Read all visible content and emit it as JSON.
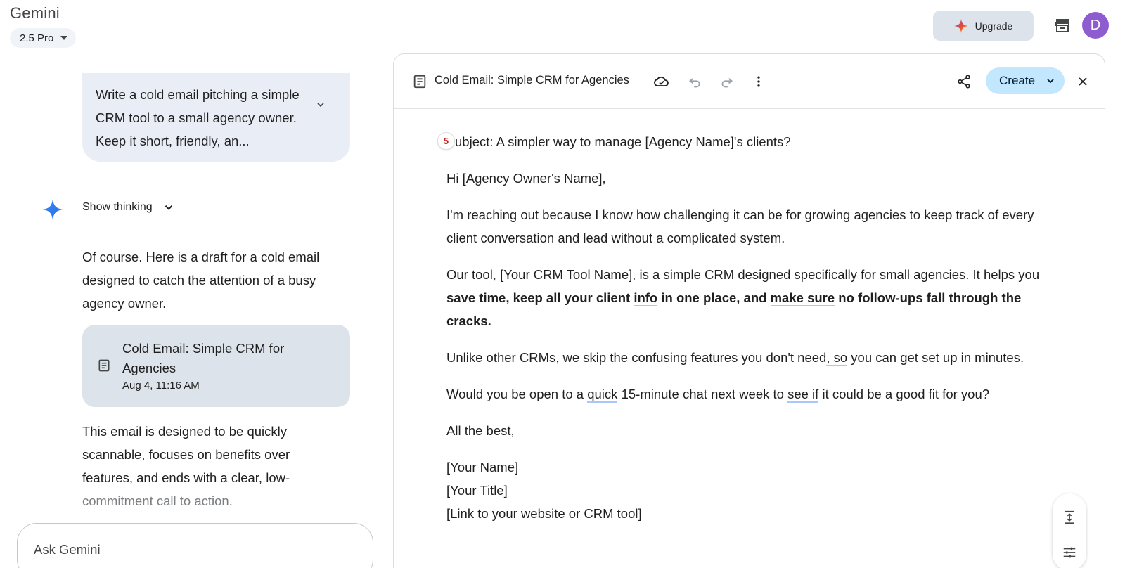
{
  "app": {
    "title": "Gemini",
    "model": "2.5 Pro"
  },
  "header": {
    "upgrade_label": "Upgrade",
    "avatar_letter": "D"
  },
  "chat": {
    "user_prompt": "Write a cold email pitching a simple CRM tool to a small agency owner. Keep it short, friendly, an...",
    "show_thinking_label": "Show thinking",
    "response_intro": "Of course. Here is a draft for a cold email designed to catch the attention of a busy agency owner.",
    "doc_card": {
      "title": "Cold Email: Simple CRM for Agencies",
      "date": "Aug 4, 11:16 AM"
    },
    "response_outro_main": "This email is designed to be quickly scannable, focuses on benefits over features, and ends with a clear, low-",
    "response_outro_faded": "commitment call to action.",
    "ask_placeholder": "Ask Gemini"
  },
  "doc_panel": {
    "title": "Cold Email: Simple CRM for Agencies",
    "create_label": "Create",
    "badge_count": "5",
    "subject": "ubject: A simpler way to manage [Agency Name]'s clients?",
    "greeting": "Hi [Agency Owner's Name],",
    "p1": "I'm reaching out because I know how challenging it can be for growing agencies to keep track of every client conversation and lead without a complicated system.",
    "p2_a": "Our tool, [Your CRM Tool Name], is a simple CRM designed specifically for small agencies. It helps you ",
    "p2_b1": "save time, keep all your client ",
    "p2_b2": "info",
    "p2_b3": " in one place, and ",
    "p2_b4": "make sure",
    "p2_b5": " no follow-ups fall through the cracks.",
    "p3_a": "Unlike other CRMs, we skip the confusing features you don't need",
    "p3_b": ", so",
    "p3_c": " you can get set up in minutes.",
    "p4_a": "Would you be open to a ",
    "p4_b": "quick",
    "p4_c": " 15-minute chat next week to ",
    "p4_d": "see if",
    "p4_e": " it could be a good fit for you?",
    "closing": "All the best,",
    "sig_name": "[Your Name]",
    "sig_title": "[Your Title]",
    "sig_link": "[Link to your website or CRM tool]"
  },
  "icons": {
    "archive": "archive-icon",
    "spark": "gemini-spark-icon",
    "doc": "document-icon",
    "cloud": "cloud-check-icon",
    "undo": "undo-icon",
    "redo": "redo-icon",
    "more": "more-vert-icon",
    "share": "share-icon",
    "close": "close-icon",
    "expand": "expand-height-icon",
    "tune": "tune-icon"
  },
  "colors": {
    "accent": "#c2e7ff",
    "avatar": "#8e5ccf",
    "spark": "#4285f4",
    "badge": "#c5221f"
  }
}
